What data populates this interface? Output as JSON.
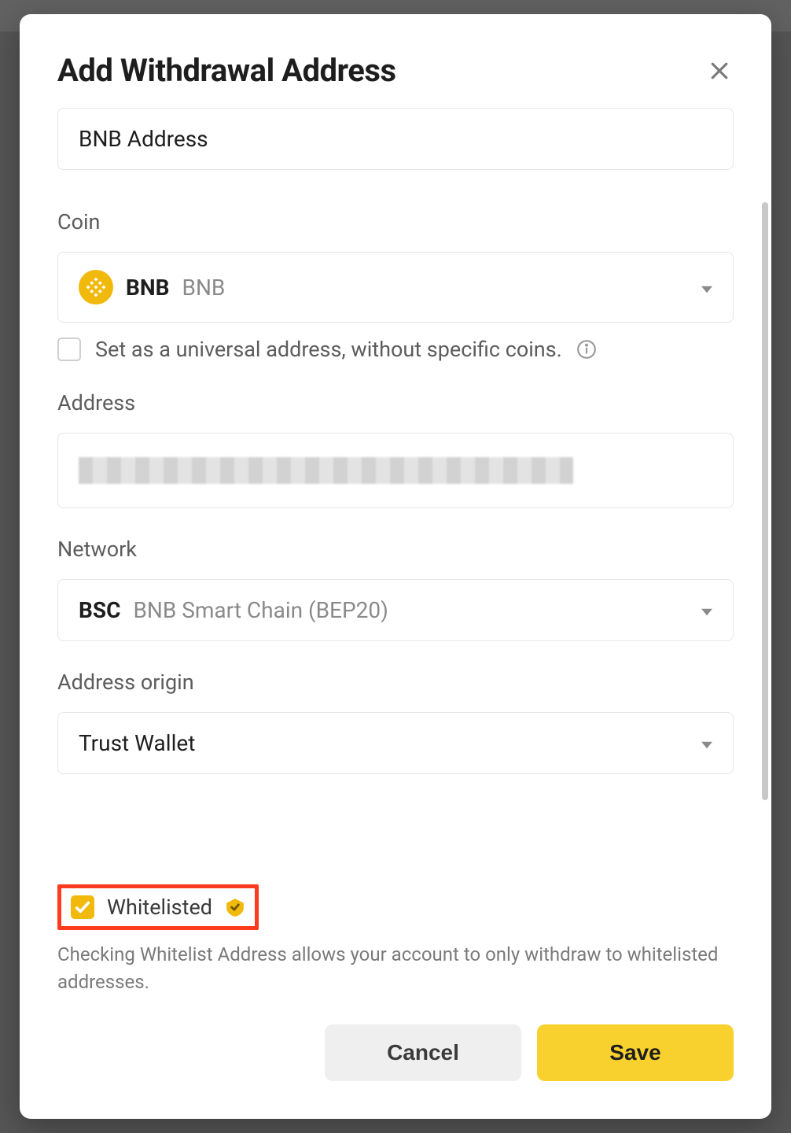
{
  "modal": {
    "title": "Add Withdrawal Address",
    "label_field": {
      "value": "BNB Address"
    },
    "coin": {
      "label": "Coin",
      "symbol": "BNB",
      "name": "BNB",
      "universal_checkbox": {
        "checked": false,
        "label": "Set as a universal address, without specific coins."
      }
    },
    "address": {
      "label": "Address"
    },
    "network": {
      "label": "Network",
      "code": "BSC",
      "name": "BNB Smart Chain (BEP20)"
    },
    "origin": {
      "label": "Address origin",
      "value": "Trust Wallet"
    },
    "whitelist": {
      "checked": true,
      "label": "Whitelisted",
      "description": "Checking Whitelist Address allows your account to only withdraw to whitelisted addresses."
    },
    "buttons": {
      "cancel": "Cancel",
      "save": "Save"
    }
  }
}
